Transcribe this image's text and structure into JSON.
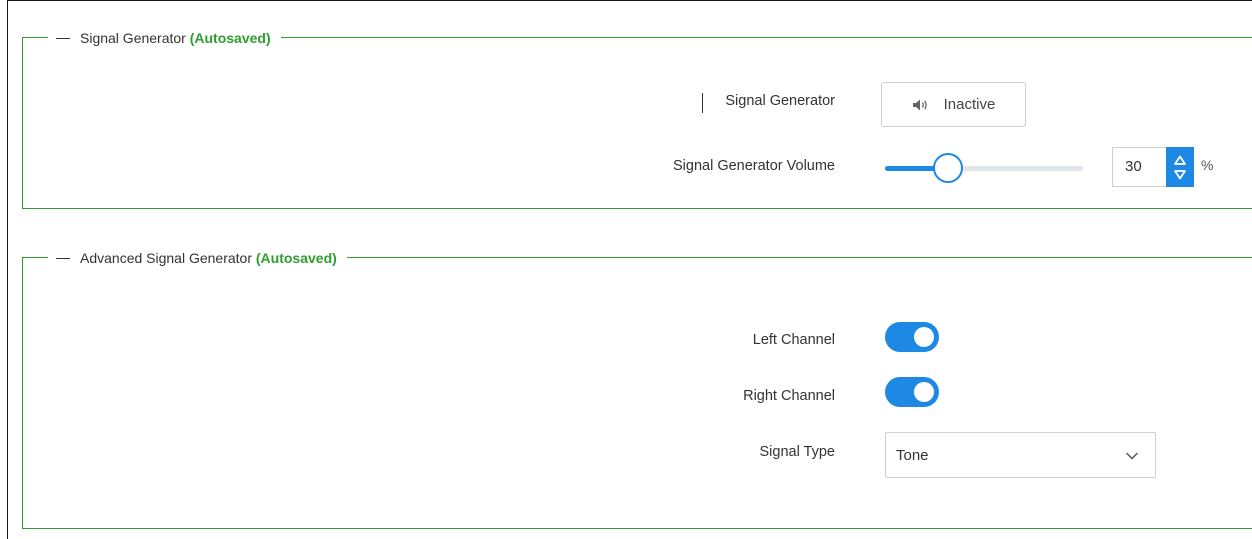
{
  "signal_generator_section": {
    "legend_title": "Signal Generator",
    "autosaved": "(Autosaved)",
    "signal_generator_label": "Signal Generator",
    "status_button_label": "Inactive",
    "status_icon": "speaker-icon",
    "volume_label": "Signal Generator Volume",
    "volume_value": "30",
    "volume_level": 30,
    "volume_unit": "%"
  },
  "advanced_section": {
    "legend_title": "Advanced Signal Generator",
    "autosaved": "(Autosaved)",
    "left_channel_label": "Left Channel",
    "left_channel_on": true,
    "right_channel_label": "Right Channel",
    "right_channel_on": true,
    "signal_type_label": "Signal Type",
    "signal_type_value": "Tone"
  },
  "colors": {
    "accent": "#1e88e5",
    "autosaved": "#2e9e2e",
    "border": "#2e9e2e"
  }
}
